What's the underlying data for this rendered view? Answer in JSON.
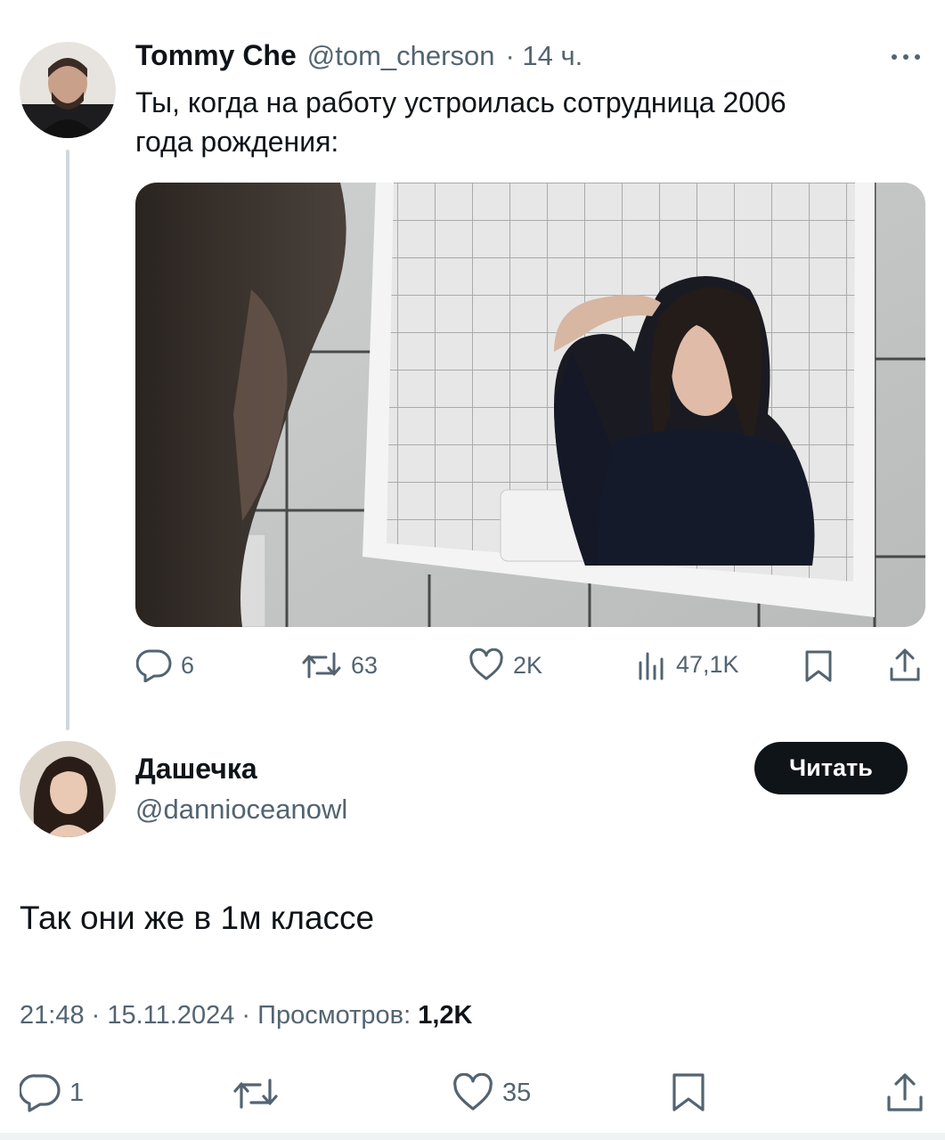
{
  "original_tweet": {
    "author_name": "Tommy Che",
    "author_handle": "@tom_cherson",
    "time": "· 14 ч.",
    "more_icon": "more-horizontal-icon",
    "text_line1": "Ты, когда на работу устроилась сотрудница 2006",
    "text_line2": "года рождения:",
    "actions": {
      "replies": "6",
      "retweets": "63",
      "likes": "2K",
      "views": "47,1K"
    }
  },
  "reply_tweet": {
    "author_name": "Дашечка",
    "author_handle": "@dannioceanowl",
    "follow_label": "Читать",
    "text": "Так они же в 1м классе",
    "meta_time_date": "21:48 · 15.11.2024 · Просмотров: ",
    "meta_views": "1,2K",
    "actions": {
      "replies": "1",
      "likes": "35"
    }
  },
  "colors": {
    "text": "#0f1419",
    "muted": "#536471",
    "thread_line": "#cfd9de",
    "button_bg": "#0f1419"
  }
}
